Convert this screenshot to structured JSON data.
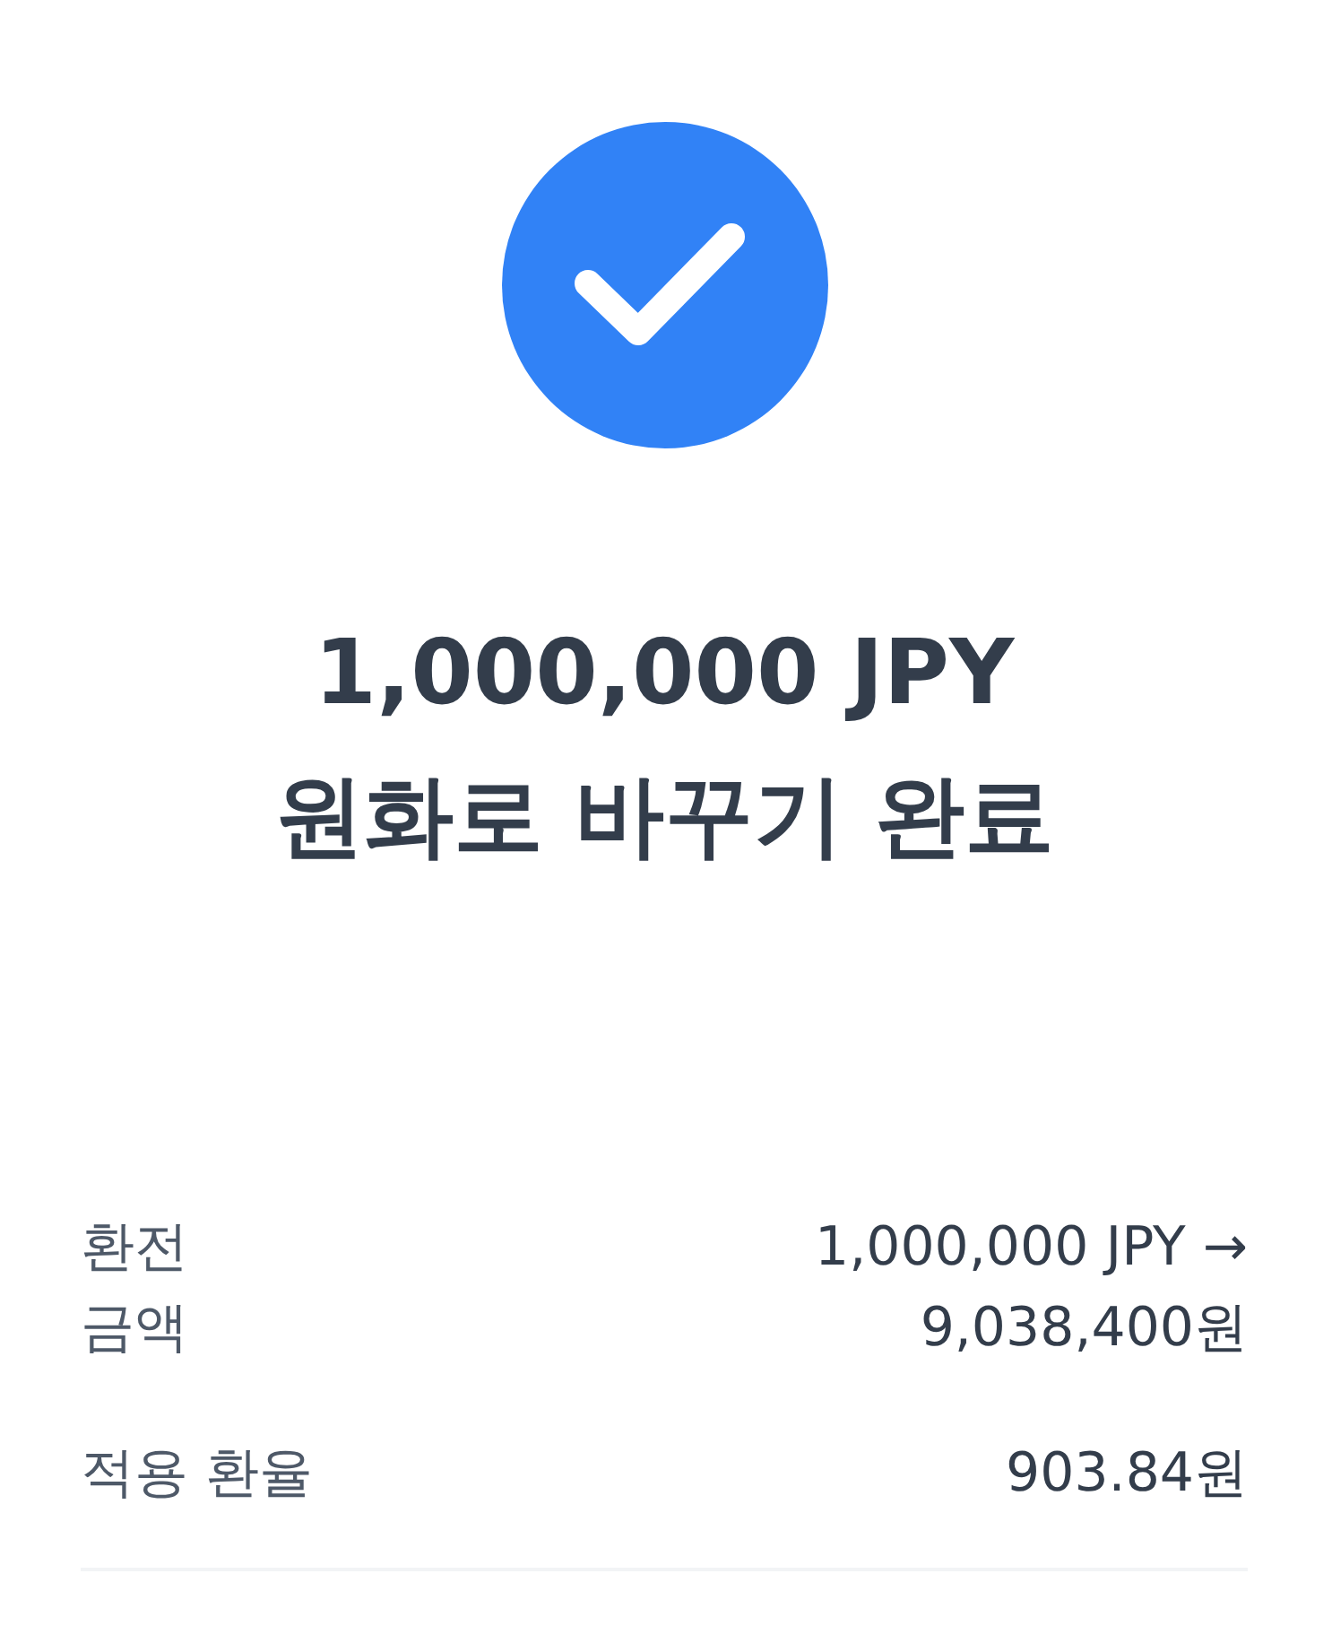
{
  "status": {
    "kind": "success"
  },
  "title": {
    "amount": "1,000,000 JPY",
    "message": "원화로 바꾸기 완료"
  },
  "details": [
    {
      "label": "환전\n금액",
      "value": "1,000,000 JPY →\n9,038,400원"
    },
    {
      "label": "적용 환율",
      "value": "903.84원"
    }
  ]
}
